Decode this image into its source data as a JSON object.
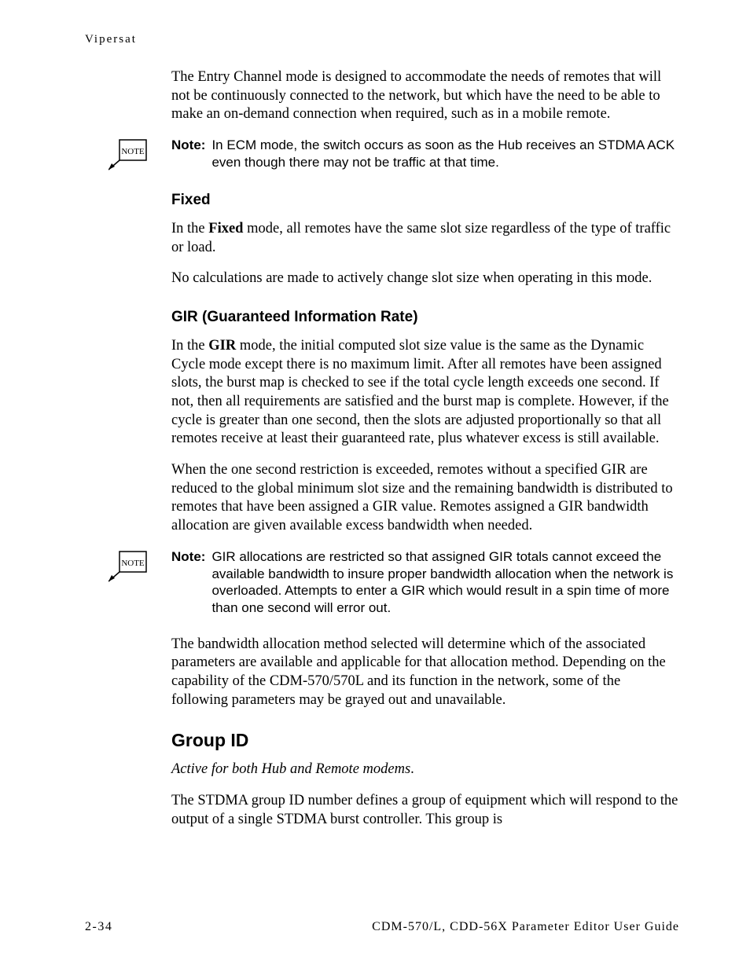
{
  "header": "Vipersat",
  "intro_para": "The Entry Channel mode is designed to accommodate the needs of remotes that will not be continuously connected to the network, but which have the need to be able to make an on-demand connection when required, such as in a mobile remote.",
  "note1": {
    "label": "Note:",
    "body": "In ECM mode, the switch occurs as soon as the Hub receives an STDMA ACK even though there may not be traffic at that time.",
    "icon_text": "NOTE"
  },
  "fixed": {
    "heading": "Fixed",
    "para1_lead": "In the ",
    "para1_bold": "Fixed",
    "para1_rest": " mode, all remotes have the same slot size regardless of the type of traffic or load.",
    "para2": "No calculations are made to actively change slot size when operating in this mode."
  },
  "gir": {
    "heading": "GIR (Guaranteed Information Rate)",
    "para1_lead": "In the ",
    "para1_bold": "GIR",
    "para1_rest": " mode, the initial computed slot size value is the same as the Dynamic Cycle mode except there is no maximum limit. After all remotes have been assigned slots, the burst map is checked to see if the total cycle length exceeds one second. If not, then all requirements are satisfied and the burst map is complete. However, if the cycle is greater than one second, then the slots are adjusted proportionally so that all remotes receive at least their guaranteed rate, plus whatever excess is still available.",
    "para2": "When the one second restriction is exceeded, remotes without a specified GIR are reduced to the global minimum slot size and the remaining bandwidth is distributed to remotes that have been assigned a GIR value. Remotes assigned a GIR bandwidth allocation are given available excess bandwidth when needed."
  },
  "note2": {
    "label": "Note:",
    "body": "GIR allocations are restricted so that assigned GIR totals cannot exceed the available bandwidth to insure proper bandwidth allocation when the network is overloaded. Attempts to enter a GIR which would result in a spin time of more than one second will error out.",
    "icon_text": "NOTE"
  },
  "alloc_para": "The bandwidth allocation method selected will determine which of the associated parameters are available and applicable for that allocation method. Depending on the capability of the CDM-570/570L and its function in the network, some of the following parameters may be grayed out and unavailable.",
  "group_id": {
    "heading": "Group ID",
    "subtitle": "Active for both Hub and Remote modems",
    "subtitle_period": ".",
    "para": "The STDMA group ID number defines a group of equipment which will respond to the output of a single STDMA burst controller. This group is"
  },
  "footer": {
    "left": "2-34",
    "right": "CDM-570/L, CDD-56X Parameter Editor User Guide"
  }
}
